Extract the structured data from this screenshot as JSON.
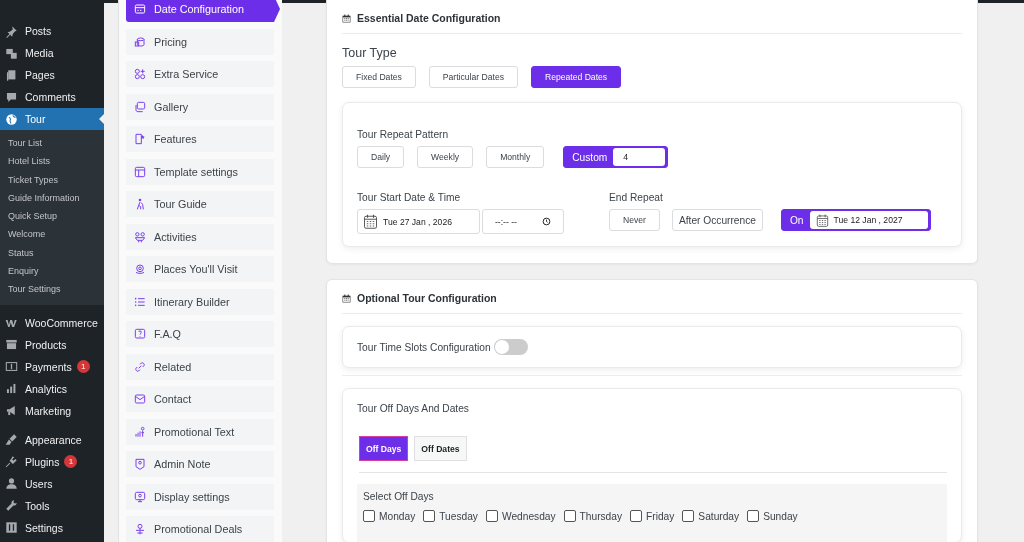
{
  "admin_menu": {
    "groups": [
      {
        "items": [
          {
            "label": "Posts",
            "selected": false
          },
          {
            "label": "Media",
            "selected": false
          },
          {
            "label": "Pages",
            "selected": false
          },
          {
            "label": "Comments",
            "selected": false
          },
          {
            "label": "Tour",
            "selected": true,
            "children": [
              {
                "label": "Tour List"
              },
              {
                "label": "Hotel Lists"
              },
              {
                "label": "Ticket Types"
              },
              {
                "label": "Guide Information"
              },
              {
                "label": "Quick Setup"
              },
              {
                "label": "Welcome"
              },
              {
                "label": "Status"
              },
              {
                "label": "Enquiry"
              },
              {
                "label": "Tour Settings"
              }
            ]
          }
        ]
      },
      {
        "items": [
          {
            "label": "WooCommerce",
            "selected": false
          },
          {
            "label": "Products",
            "selected": false
          },
          {
            "label": "Payments",
            "selected": false,
            "badge": "1"
          },
          {
            "label": "Analytics",
            "selected": false
          },
          {
            "label": "Marketing",
            "selected": false
          }
        ]
      },
      {
        "items": [
          {
            "label": "Appearance",
            "selected": false
          },
          {
            "label": "Plugins",
            "selected": false,
            "badge": "1"
          },
          {
            "label": "Users",
            "selected": false
          },
          {
            "label": "Tools",
            "selected": false
          },
          {
            "label": "Settings",
            "selected": false
          }
        ]
      }
    ]
  },
  "tabs": [
    {
      "label": "Date Configuration",
      "selected": true
    },
    {
      "label": "Pricing",
      "selected": false
    },
    {
      "label": "Extra Service",
      "selected": false
    },
    {
      "label": "Gallery",
      "selected": false
    },
    {
      "label": "Features",
      "selected": false
    },
    {
      "label": "Template settings",
      "selected": false
    },
    {
      "label": "Tour Guide",
      "selected": false
    },
    {
      "label": "Activities",
      "selected": false
    },
    {
      "label": "Places You'll Visit",
      "selected": false
    },
    {
      "label": "Itinerary Builder",
      "selected": false
    },
    {
      "label": "F.A.Q",
      "selected": false
    },
    {
      "label": "Related",
      "selected": false
    },
    {
      "label": "Contact",
      "selected": false
    },
    {
      "label": "Promotional Text",
      "selected": false
    },
    {
      "label": "Admin Note",
      "selected": false
    },
    {
      "label": "Display settings",
      "selected": false
    },
    {
      "label": "Promotional Deals",
      "selected": false
    }
  ],
  "essential": {
    "title": "Essential Date Configuration",
    "tour_type": {
      "label": "Tour Type",
      "options": [
        {
          "label": "Fixed Dates",
          "selected": false
        },
        {
          "label": "Particular Dates",
          "selected": false
        },
        {
          "label": "Repeated Dates",
          "selected": true
        }
      ]
    },
    "repeat_pattern": {
      "label": "Tour Repeat Pattern",
      "options": [
        {
          "label": "Daily",
          "selected": false,
          "kind": "button"
        },
        {
          "label": "Weekly",
          "selected": false,
          "kind": "button"
        },
        {
          "label": "Monthly",
          "selected": false,
          "kind": "button"
        },
        {
          "label": "Custom",
          "selected": true,
          "kind": "custom",
          "value": "4"
        }
      ]
    },
    "start": {
      "label": "Tour Start Date & Time",
      "date": "Tue 27 Jan , 2026",
      "time": "--:-- --"
    },
    "end_repeat": {
      "label": "End Repeat",
      "options": [
        {
          "label": "Never",
          "selected": false,
          "kind": "button"
        },
        {
          "label": "After Occurrence",
          "selected": false,
          "kind": "field"
        },
        {
          "label": "On",
          "selected": true,
          "kind": "date",
          "value": "Tue 12 Jan , 2027"
        }
      ]
    }
  },
  "optional": {
    "title": "Optional Tour Configuration",
    "time_slots": {
      "label": "Tour Time Slots Configuration",
      "on": false
    },
    "off": {
      "title": "Tour Off Days And Dates",
      "tabs": [
        {
          "label": "Off Days",
          "selected": true
        },
        {
          "label": "Off Dates",
          "selected": false
        }
      ],
      "days_label": "Select Off Days",
      "days": [
        {
          "label": "Monday",
          "checked": false
        },
        {
          "label": "Tuesday",
          "checked": false
        },
        {
          "label": "Wednesday",
          "checked": false
        },
        {
          "label": "Thursday",
          "checked": false
        },
        {
          "label": "Friday",
          "checked": false
        },
        {
          "label": "Saturday",
          "checked": false
        },
        {
          "label": "Sunday",
          "checked": false
        }
      ]
    }
  }
}
